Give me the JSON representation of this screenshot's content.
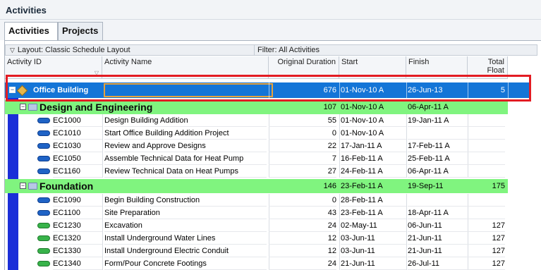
{
  "window": {
    "title": "Activities"
  },
  "tabs": [
    {
      "label": "Activities",
      "active": true
    },
    {
      "label": "Projects",
      "active": false
    }
  ],
  "toolbar": {
    "layout_label": "Layout: Classic Schedule Layout",
    "filter_label": "Filter: All Activities"
  },
  "columns": {
    "activity_id": "Activity ID",
    "activity_name": "Activity Name",
    "original_duration": "Original Duration",
    "start": "Start",
    "finish": "Finish",
    "total_float": "Total Float"
  },
  "project": {
    "name": "Office Building",
    "duration": "676",
    "start": "01-Nov-10 A",
    "finish": "26-Jun-13",
    "total_float": "5"
  },
  "groups": [
    {
      "name": "Design and Engineering",
      "duration": "107",
      "start": "01-Nov-10 A",
      "finish": "06-Apr-11 A",
      "total_float": "",
      "activities": [
        {
          "id": "EC1000",
          "name": "Design Building Addition",
          "duration": "55",
          "start": "01-Nov-10 A",
          "finish": "19-Jan-11 A",
          "total_float": "",
          "bar": "blue"
        },
        {
          "id": "EC1010",
          "name": "Start Office Building Addition Project",
          "duration": "0",
          "start": "01-Nov-10 A",
          "finish": "",
          "total_float": "",
          "bar": "blue"
        },
        {
          "id": "EC1030",
          "name": "Review and Approve Designs",
          "duration": "22",
          "start": "17-Jan-11 A",
          "finish": "17-Feb-11 A",
          "total_float": "",
          "bar": "blue"
        },
        {
          "id": "EC1050",
          "name": "Assemble Technical Data for Heat Pump",
          "duration": "7",
          "start": "16-Feb-11 A",
          "finish": "25-Feb-11 A",
          "total_float": "",
          "bar": "blue"
        },
        {
          "id": "EC1160",
          "name": "Review Technical Data on Heat Pumps",
          "duration": "27",
          "start": "24-Feb-11 A",
          "finish": "06-Apr-11 A",
          "total_float": "",
          "bar": "blue"
        }
      ]
    },
    {
      "name": "Foundation",
      "duration": "146",
      "start": "23-Feb-11 A",
      "finish": "19-Sep-11",
      "total_float": "175",
      "activities": [
        {
          "id": "EC1090",
          "name": "Begin Building Construction",
          "duration": "0",
          "start": "28-Feb-11 A",
          "finish": "",
          "total_float": "",
          "bar": "blue"
        },
        {
          "id": "EC1100",
          "name": "Site Preparation",
          "duration": "43",
          "start": "23-Feb-11 A",
          "finish": "18-Apr-11 A",
          "total_float": "",
          "bar": "blue"
        },
        {
          "id": "EC1230",
          "name": "Excavation",
          "duration": "24",
          "start": "02-May-11",
          "finish": "06-Jun-11",
          "total_float": "127",
          "bar": "green"
        },
        {
          "id": "EC1320",
          "name": "Install Underground Water Lines",
          "duration": "12",
          "start": "03-Jun-11",
          "finish": "21-Jun-11",
          "total_float": "127",
          "bar": "green"
        },
        {
          "id": "EC1330",
          "name": "Install Underground Electric Conduit",
          "duration": "12",
          "start": "03-Jun-11",
          "finish": "21-Jun-11",
          "total_float": "127",
          "bar": "green"
        },
        {
          "id": "EC1340",
          "name": "Form/Pour Concrete Footings",
          "duration": "24",
          "start": "21-Jun-11",
          "finish": "26-Jul-11",
          "total_float": "127",
          "bar": "green"
        }
      ]
    }
  ],
  "colors": {
    "project_row": "#1475d7",
    "wbs_row": "#80f47f",
    "highlight": "#e31c23",
    "blue_strip": "#1a2ed8"
  }
}
